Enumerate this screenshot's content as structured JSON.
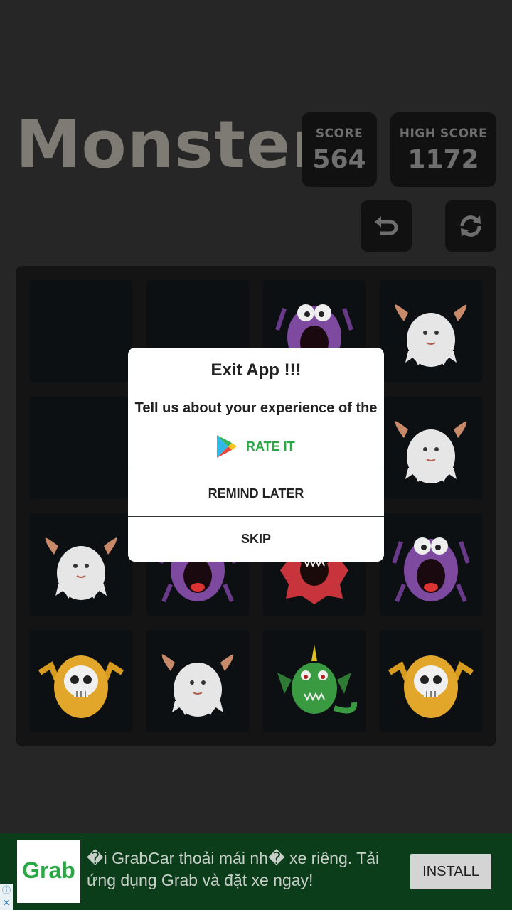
{
  "game": {
    "title": "Monster",
    "score_label": "SCORE",
    "score_value": "564",
    "high_score_label": "HIGH SCORE",
    "high_score_value": "1172",
    "undo_icon": "undo-icon",
    "restart_icon": "refresh-icon"
  },
  "board": {
    "rows": [
      [
        "empty",
        "empty",
        "purple-monster",
        "white-yeti"
      ],
      [
        "empty",
        "empty",
        "empty",
        "white-yeti"
      ],
      [
        "white-yeti",
        "purple-monster",
        "red-monster",
        "purple-monster"
      ],
      [
        "yellow-skull-monster",
        "white-yeti",
        "green-dragon",
        "yellow-skull-monster"
      ]
    ]
  },
  "dialog": {
    "title": "Exit App !!!",
    "message": "Tell us about your experience of the",
    "rate_label": "RATE IT",
    "remind_label": "REMIND LATER",
    "skip_label": "SKIP"
  },
  "ad": {
    "brand": "Grab",
    "text": "�i GrabCar thoải mái nh� xe riêng. Tải ứng dụng Grab và đặt xe ngay!",
    "install_label": "INSTALL",
    "info_icon": "ⓘ",
    "close_icon": "✕"
  },
  "colors": {
    "background": "#262626",
    "tile": "#0c1013",
    "rate_green": "#2aa844",
    "ad_bg": "#0c3d1b"
  }
}
